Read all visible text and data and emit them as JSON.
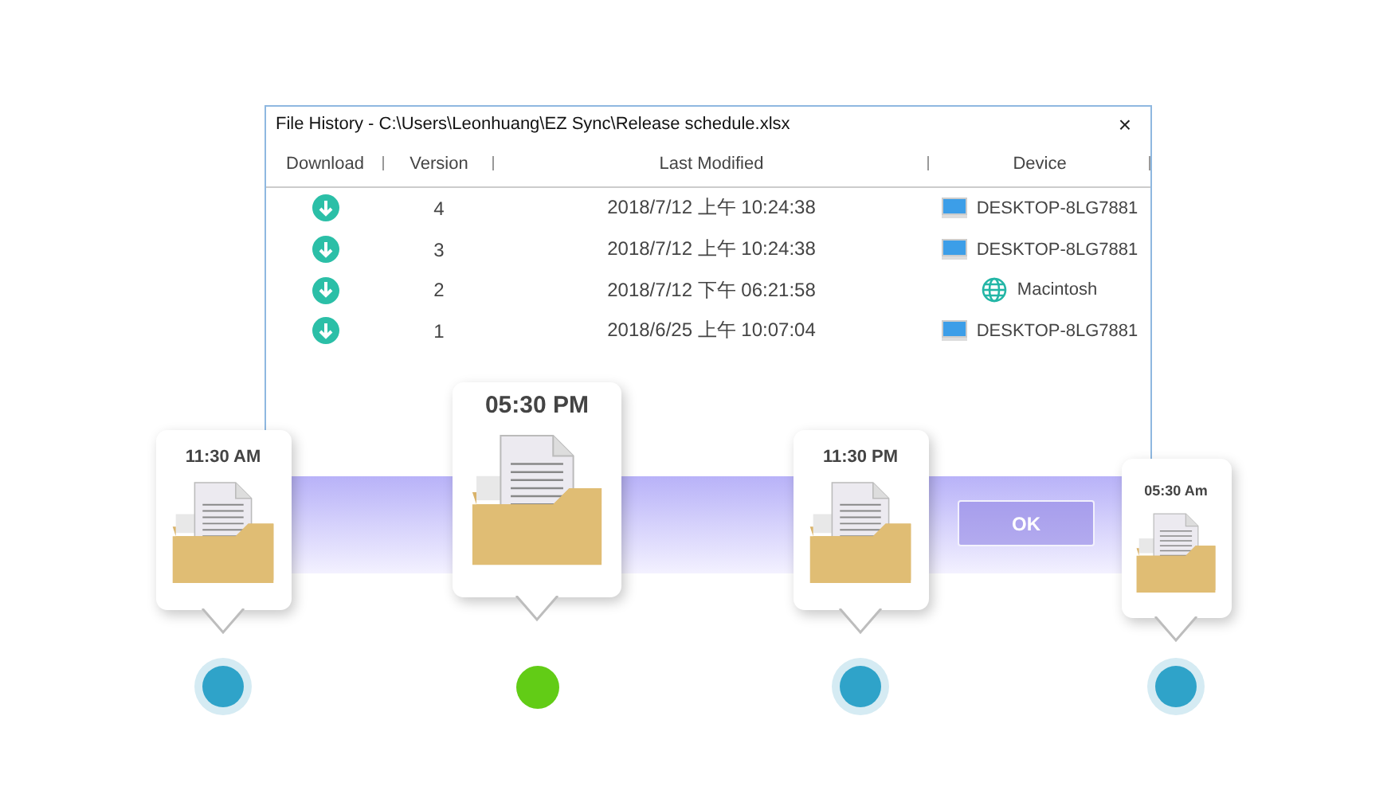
{
  "window": {
    "title": "File History - C:\\Users\\Leonhuang\\EZ Sync\\Release schedule.xlsx",
    "close": "×"
  },
  "table": {
    "columns": [
      "Download",
      "Version",
      "Last Modified",
      "Device"
    ],
    "rows": [
      {
        "version": "4",
        "modified": "2018/7/12 上午 10:24:38",
        "device": "DESKTOP-8LG7881",
        "kind": "desktop"
      },
      {
        "version": "3",
        "modified": "2018/7/12 上午 10:24:38",
        "device": "DESKTOP-8LG7881",
        "kind": "desktop"
      },
      {
        "version": "2",
        "modified": "2018/7/12 下午 06:21:58",
        "device": "Macintosh",
        "kind": "globe"
      },
      {
        "version": "1",
        "modified": "2018/6/25 上午 10:07:04",
        "device": "DESKTOP-8LG7881",
        "kind": "desktop"
      }
    ]
  },
  "ok_button": "OK",
  "timeline": [
    {
      "time": "11:30 AM",
      "kind": "medium",
      "selected": false
    },
    {
      "time": "05:30 PM",
      "kind": "large",
      "selected": true
    },
    {
      "time": "11:30 PM",
      "kind": "medium",
      "selected": false
    },
    {
      "time": "05:30 Am",
      "kind": "small",
      "selected": false
    }
  ]
}
